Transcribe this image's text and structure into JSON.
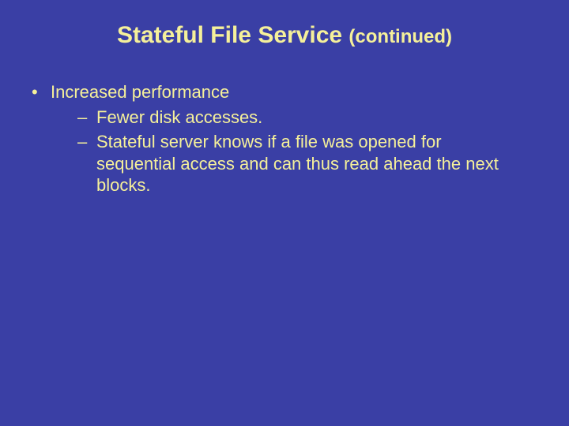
{
  "title": {
    "main": "Stateful File Service ",
    "suffix": "(continued)"
  },
  "bullets": {
    "b1": "Increased performance",
    "b1a": "Fewer disk accesses.",
    "b1b": "Stateful server knows if a file was opened for sequential access and can thus read ahead the next blocks."
  }
}
